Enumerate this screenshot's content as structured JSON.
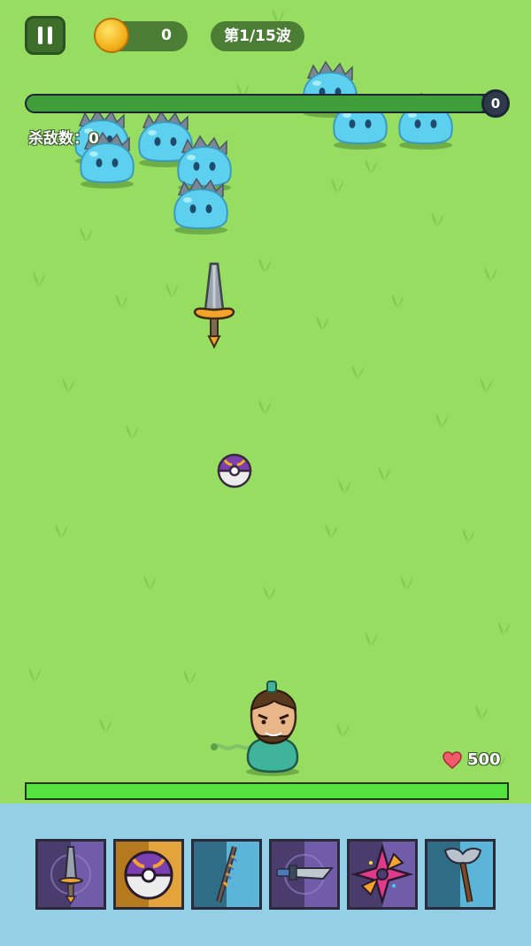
{
  "hud": {
    "coins": "0",
    "wave_label": "第1/15波",
    "wave_progress_value": "0",
    "wave_progress_fraction": 0.97,
    "kills_label": "杀敌数：",
    "kills_value": "0"
  },
  "player": {
    "hp": "500",
    "hp_fraction": 1.0
  },
  "items": [
    {
      "name": "sword-icon",
      "bg": "#5b4a8c"
    },
    {
      "name": "pokeball-icon",
      "bg": "#e3a232"
    },
    {
      "name": "spear-icon",
      "bg": "#4aa2c4"
    },
    {
      "name": "dagger-icon",
      "bg": "#5b4a8c"
    },
    {
      "name": "shuriken-icon",
      "bg": "#5b4a8c"
    },
    {
      "name": "axe-icon",
      "bg": "#4aa2c4"
    }
  ],
  "colors": {
    "grass": "#97dd61",
    "hud_bg": "#4c7d35",
    "hp_bar": "#55e23e",
    "panel": "#95cfe6"
  }
}
